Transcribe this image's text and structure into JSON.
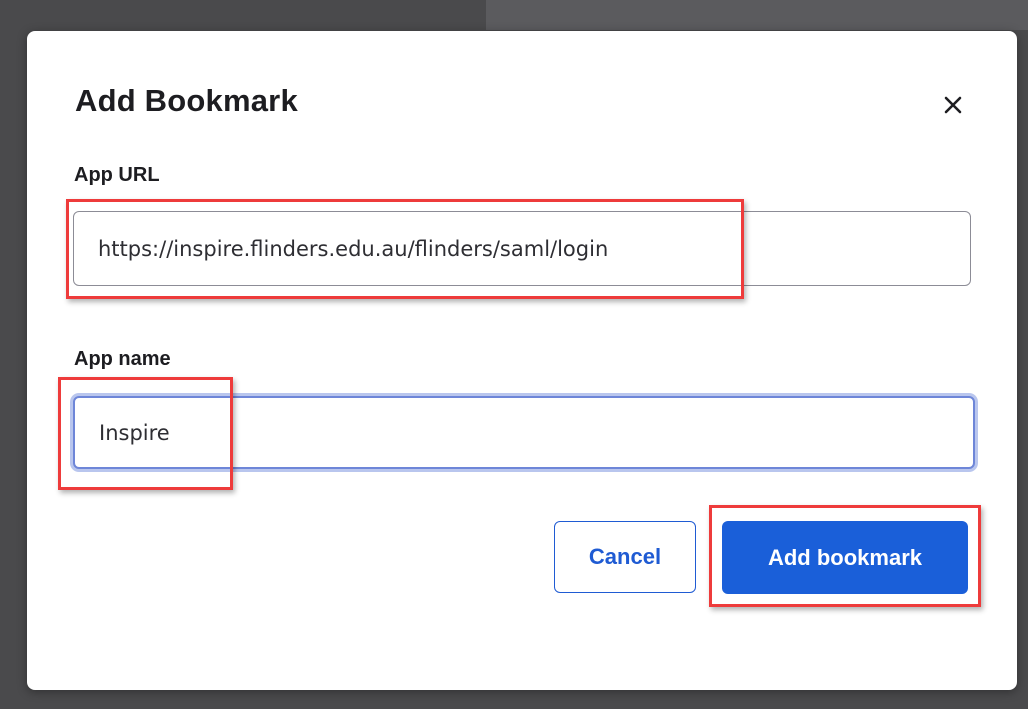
{
  "dialog": {
    "title": "Add Bookmark",
    "close_icon": "close-icon"
  },
  "fields": {
    "url": {
      "label": "App URL",
      "value": "https://inspire.flinders.edu.au/flinders/saml/login"
    },
    "name": {
      "label": "App name",
      "value": "Inspire"
    }
  },
  "buttons": {
    "cancel": "Cancel",
    "add": "Add bookmark"
  },
  "colors": {
    "primary": "#1a5fd9",
    "highlight": "#ee3b3b",
    "focus_ring": "#6e86d8"
  }
}
